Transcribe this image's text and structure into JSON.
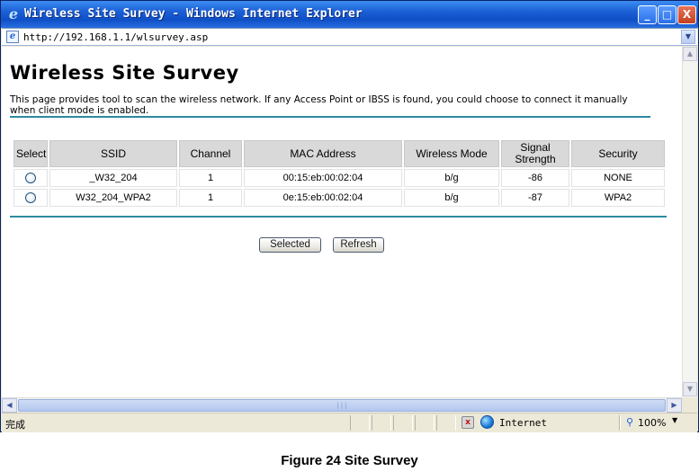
{
  "window": {
    "title": "Wireless Site Survey - Windows Internet Explorer",
    "min_glyph": "_",
    "max_glyph": "□",
    "close_glyph": "X"
  },
  "address_bar": {
    "url": "http://192.168.1.1/wlsurvey.asp"
  },
  "page": {
    "heading": "Wireless Site Survey",
    "description": "This page provides tool to scan the wireless network. If any Access Point or IBSS is found, you could choose to connect it manually when client mode is enabled."
  },
  "table": {
    "headers": [
      "Select",
      "SSID",
      "Channel",
      "MAC Address",
      "Wireless Mode",
      "Signal Strength",
      "Security"
    ],
    "rows": [
      {
        "ssid": "_W32_204",
        "channel": "1",
        "mac": "00:15:eb:00:02:04",
        "mode": "b/g",
        "signal": "-86",
        "security": "NONE"
      },
      {
        "ssid": "W32_204_WPA2",
        "channel": "1",
        "mac": "0e:15:eb:00:02:04",
        "mode": "b/g",
        "signal": "-87",
        "security": "WPA2"
      }
    ]
  },
  "buttons": {
    "selected": "Selected",
    "refresh": "Refresh"
  },
  "statusbar": {
    "text": "完成",
    "zone": "Internet",
    "zoom": "100%"
  },
  "icons": {
    "ie": "ie-logo-icon",
    "page": "page-icon",
    "globe": "globe-icon",
    "zoom": "zoom-icon"
  },
  "colors": {
    "titlebar": "#1b5fd4",
    "rule": "#2d8aa0",
    "header_cell": "#d9d9d9"
  },
  "caption": "Figure 24 Site Survey"
}
